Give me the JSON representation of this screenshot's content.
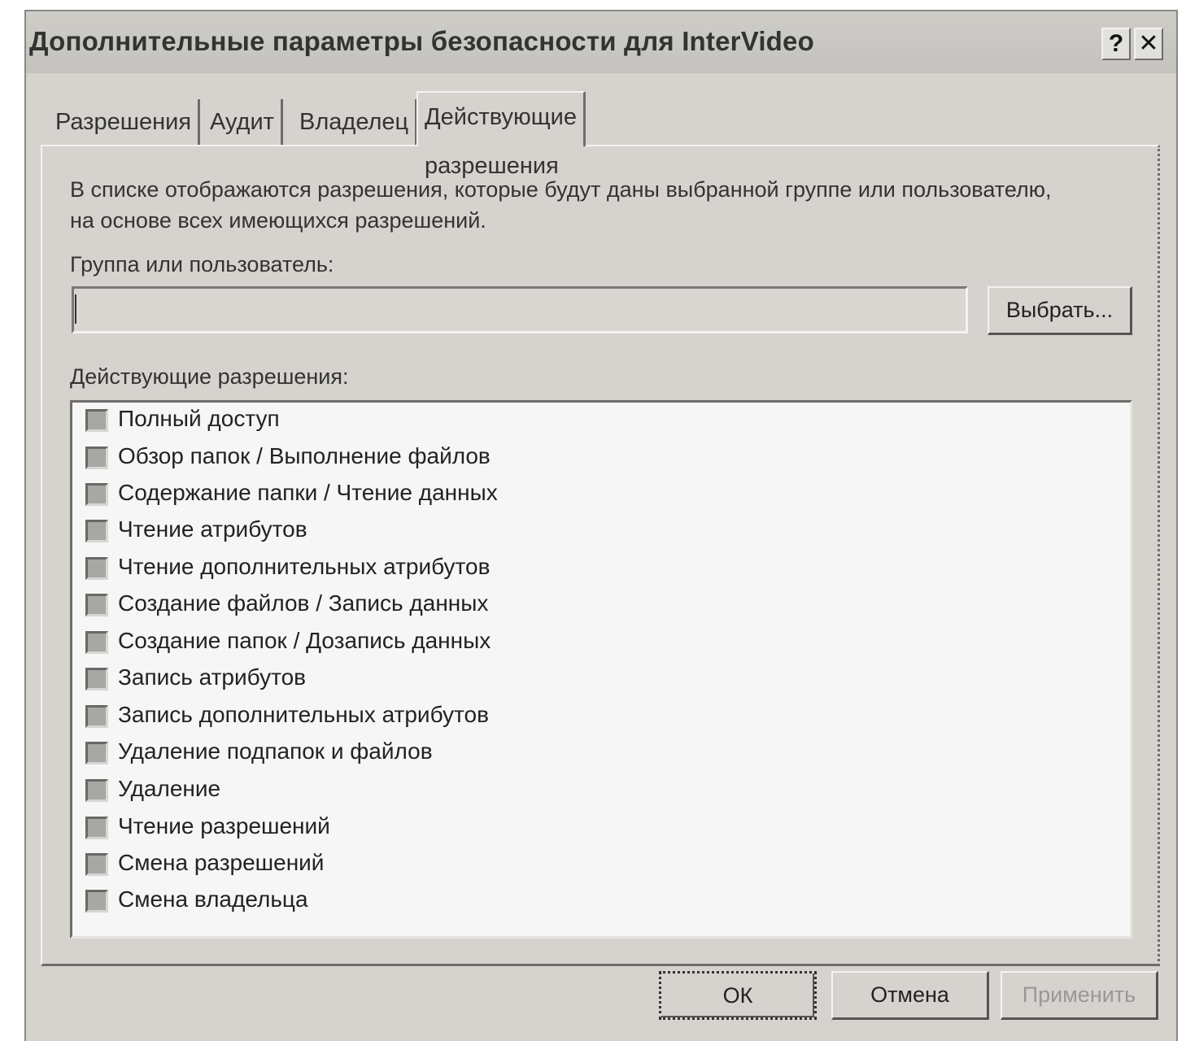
{
  "window": {
    "title": "Дополнительные параметры безопасности для InterVideo",
    "help_label": "?",
    "close_label": "✕"
  },
  "tabs": [
    {
      "label": "Разрешения"
    },
    {
      "label": "Аудит"
    },
    {
      "label": "Владелец"
    },
    {
      "label": "Действующие разрешения"
    }
  ],
  "active_tab": "Действующие разрешения",
  "panel": {
    "description_line1": "В списке отображаются разрешения, которые будут даны выбранной группе или пользователю,",
    "description_line2": "на основе всех имеющихся разрешений.",
    "group_label": "Группа или пользователь:",
    "group_value": "",
    "select_button": "Выбрать...",
    "permissions_label": "Действующие разрешения:",
    "permissions": [
      {
        "label": "Полный доступ",
        "checked": false
      },
      {
        "label": "Обзор папок / Выполнение файлов",
        "checked": false
      },
      {
        "label": "Содержание папки / Чтение данных",
        "checked": false
      },
      {
        "label": "Чтение атрибутов",
        "checked": false
      },
      {
        "label": "Чтение дополнительных атрибутов",
        "checked": false
      },
      {
        "label": "Создание файлов / Запись данных",
        "checked": false
      },
      {
        "label": "Создание папок / Дозапись данных",
        "checked": false
      },
      {
        "label": "Запись атрибутов",
        "checked": false
      },
      {
        "label": "Запись дополнительных атрибутов",
        "checked": false
      },
      {
        "label": "Удаление подпапок и файлов",
        "checked": false
      },
      {
        "label": "Удаление",
        "checked": false
      },
      {
        "label": "Чтение разрешений",
        "checked": false
      },
      {
        "label": "Смена разрешений",
        "checked": false
      },
      {
        "label": "Смена владельца",
        "checked": false
      }
    ]
  },
  "buttons": {
    "ok": "ОК",
    "cancel": "Отмена",
    "apply": "Применить"
  }
}
